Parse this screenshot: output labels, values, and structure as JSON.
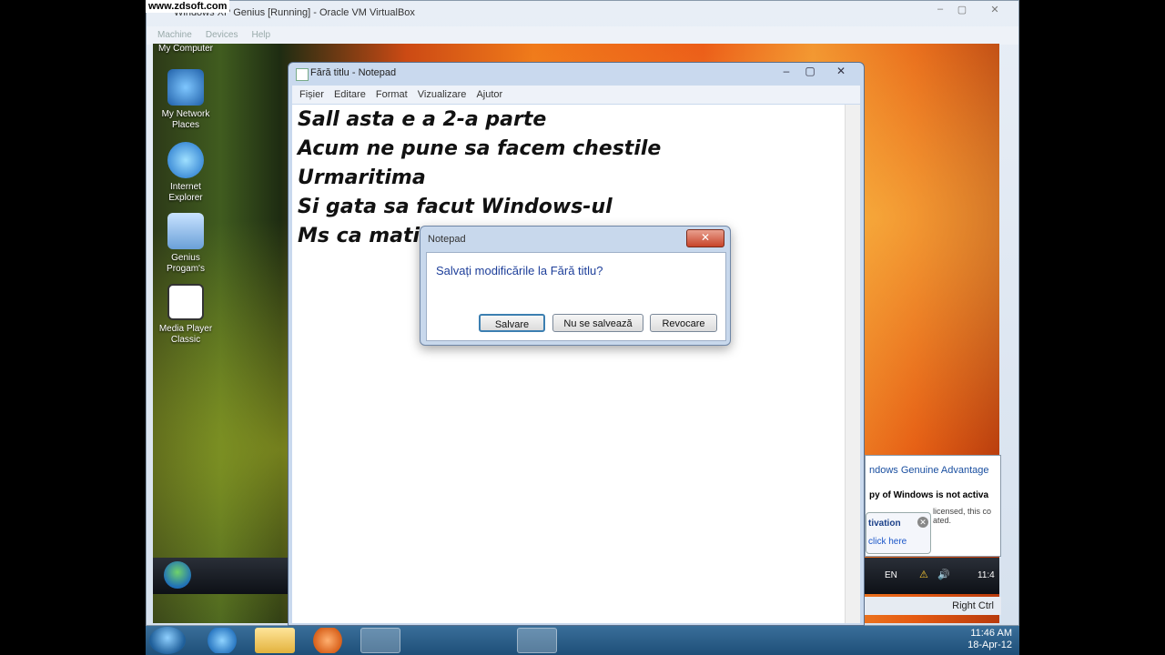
{
  "watermark": "www.zdsoft.com",
  "host_window": {
    "title": "Windows XP Genius [Running] - Oracle VM VirtualBox",
    "menu": [
      "Machine",
      "Devices",
      "Help"
    ],
    "status_right": "Right Ctrl"
  },
  "desktop_icons": [
    {
      "label": "My Computer"
    },
    {
      "label": "My Network Places"
    },
    {
      "label": "Internet Explorer"
    },
    {
      "label": "Genius Progam's"
    },
    {
      "label": "Media Player Classic"
    }
  ],
  "notepad": {
    "title": "Fără titlu - Notepad",
    "menu": [
      "Fișier",
      "Editare",
      "Format",
      "Vizualizare",
      "Ajutor"
    ],
    "lines": [
      "Sall asta e a 2-a parte",
      "Acum ne pune sa facem chestile",
      "Urmaritima",
      "Si gata sa facut Windows-ul",
      "Ms ca mati v"
    ]
  },
  "dialog": {
    "title": "Notepad",
    "message": "Salvați modificările la Fără titlu?",
    "buttons": {
      "save": "Salvare",
      "no_save": "Nu se salvează",
      "cancel": "Revocare"
    }
  },
  "wga": {
    "header": "ndows Genuine Advantage",
    "bold_line": "py of Windows is not activa",
    "small_line": "licensed, this co ated.",
    "popup_title": "tivation",
    "link": "click here"
  },
  "guest_tray": {
    "lang": "EN",
    "time": "11:4"
  },
  "host_tray": {
    "time": "11:46 AM",
    "date": "18-Apr-12"
  }
}
